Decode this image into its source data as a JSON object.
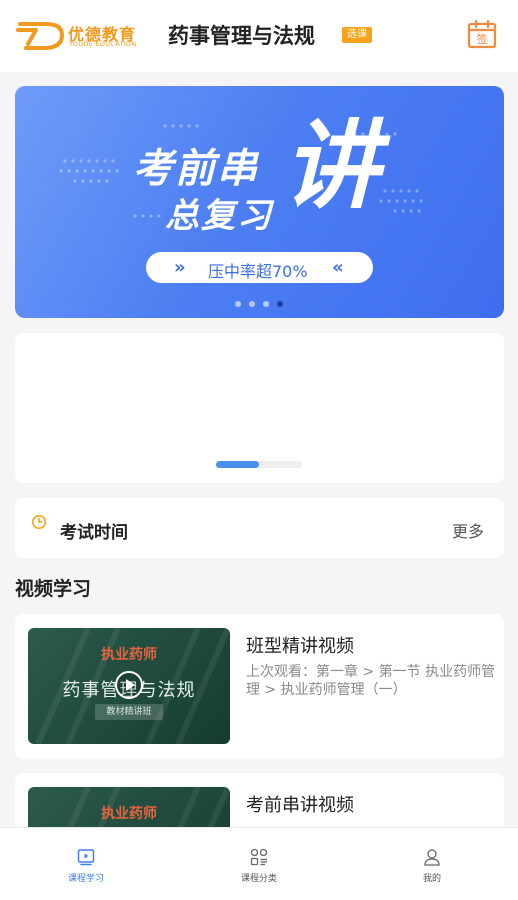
{
  "header": {
    "logo_cn": "优德教育",
    "logo_en": "YOUDE EDUCATION",
    "title": "药事管理与法规",
    "select_badge": "选课",
    "sign_icon": "calendar-sign-icon",
    "sign_text": "签"
  },
  "banner": {
    "line1": "考前串",
    "line2": "总复习",
    "big": "讲",
    "pill_text": "压中率超70%",
    "pill_arrow_left": "»",
    "pill_arrow_right": "«",
    "slides_count": 4,
    "active_slide": 4,
    "colors": {
      "start": "#6f9cf9",
      "end": "#3e6ef0"
    }
  },
  "panel": {
    "scroll_fraction": 0.5,
    "accent": "#4a8ef0"
  },
  "exam": {
    "icon": "clock-icon",
    "label": "考试时间",
    "more": "更多",
    "icon_color": "#f7a31a"
  },
  "video_section": {
    "title": "视频学习"
  },
  "courses": [
    {
      "name": "班型精讲视频",
      "progress": "上次观看：第一章 > 第一节 执业药师管理 > 执业药师管理（一）",
      "thumb_tag": "执业药师",
      "thumb_title": "药事管理与法规",
      "thumb_sub": "教材精讲班"
    },
    {
      "name": "考前串讲视频",
      "progress": "",
      "thumb_tag": "执业药师",
      "thumb_title": "",
      "thumb_sub": ""
    }
  ],
  "tabbar": {
    "items": [
      {
        "label": "课程学习",
        "icon": "play-video-icon",
        "active": true
      },
      {
        "label": "课程分类",
        "icon": "grid-category-icon",
        "active": false
      },
      {
        "label": "我的",
        "icon": "user-icon",
        "active": false
      }
    ],
    "active_color": "#3f7ef0"
  }
}
